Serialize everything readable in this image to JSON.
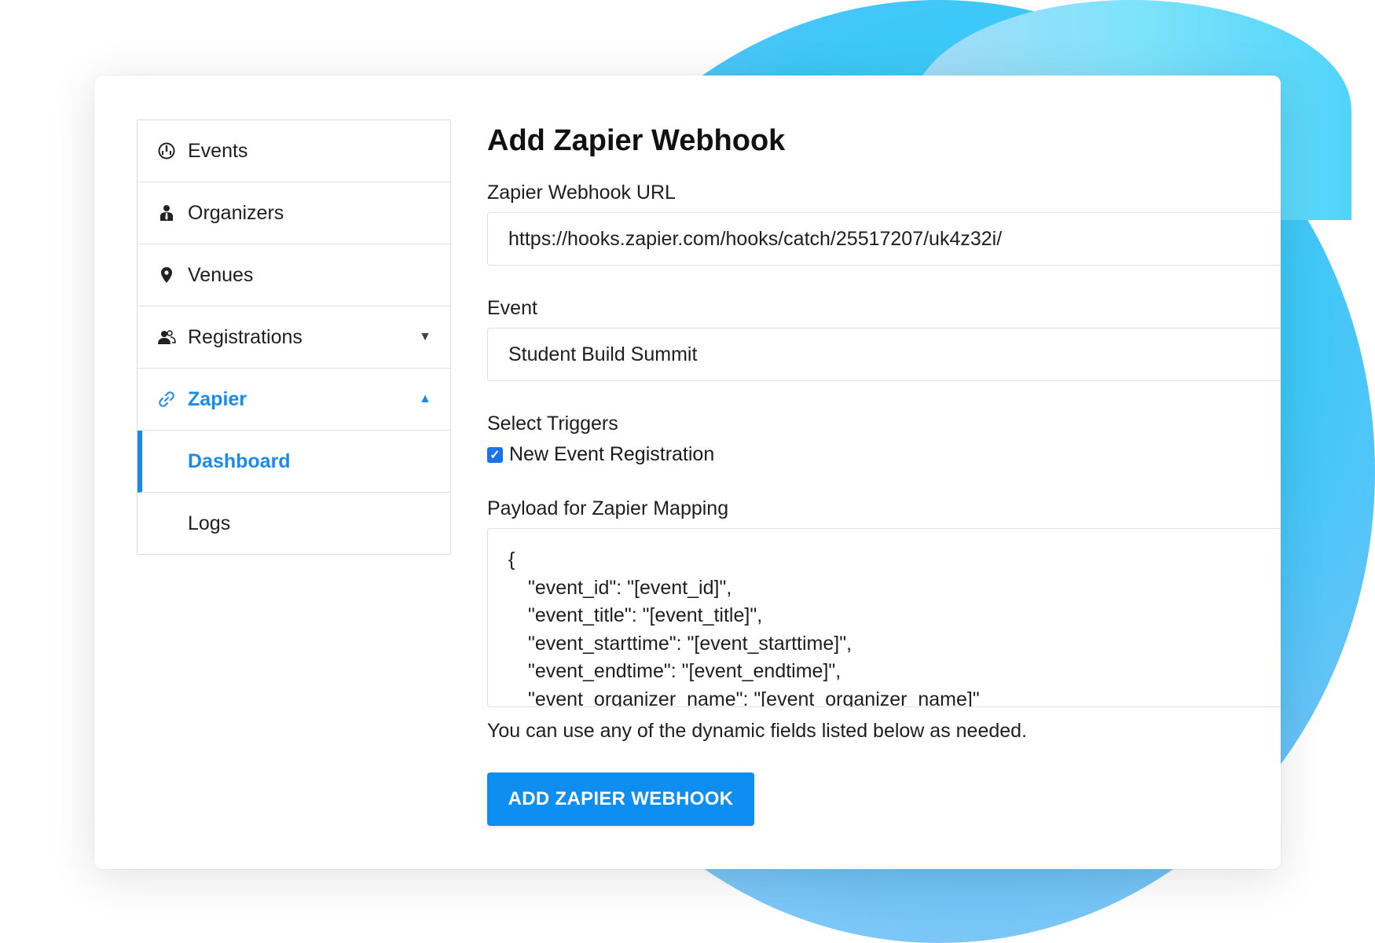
{
  "sidebar": {
    "items": [
      {
        "label": "Events",
        "icon": "dashboard-gauge-icon"
      },
      {
        "label": "Organizers",
        "icon": "person-tie-icon"
      },
      {
        "label": "Venues",
        "icon": "map-pin-icon"
      },
      {
        "label": "Registrations",
        "icon": "users-icon",
        "caret": "▼"
      },
      {
        "label": "Zapier",
        "icon": "link-icon",
        "caret": "▲"
      }
    ],
    "subitems": [
      {
        "label": "Dashboard"
      },
      {
        "label": "Logs"
      }
    ]
  },
  "main": {
    "title": "Add Zapier Webhook",
    "url_label": "Zapier Webhook URL",
    "url_value": "https://hooks.zapier.com/hooks/catch/25517207/uk4z32i/",
    "event_label": "Event",
    "event_value": "Student Build Summit",
    "triggers_label": "Select Triggers",
    "trigger_option": "New Event Registration",
    "trigger_checked": true,
    "payload_label": "Payload for Zapier Mapping",
    "payload_lines": [
      "{",
      "\"event_id\": \"[event_id]\",",
      "\"event_title\": \"[event_title]\",",
      "\"event_starttime\": \"[event_starttime]\",",
      "\"event_endtime\": \"[event_endtime]\",",
      "\"event_organizer_name\": \"[event_organizer_name]\""
    ],
    "hint": "You can use any of the dynamic fields listed below as needed.",
    "submit_label": "ADD ZAPIER WEBHOOK"
  },
  "colors": {
    "accent": "#1a8be8",
    "button": "#0d8ef0",
    "blob": "#3cc8f8"
  }
}
